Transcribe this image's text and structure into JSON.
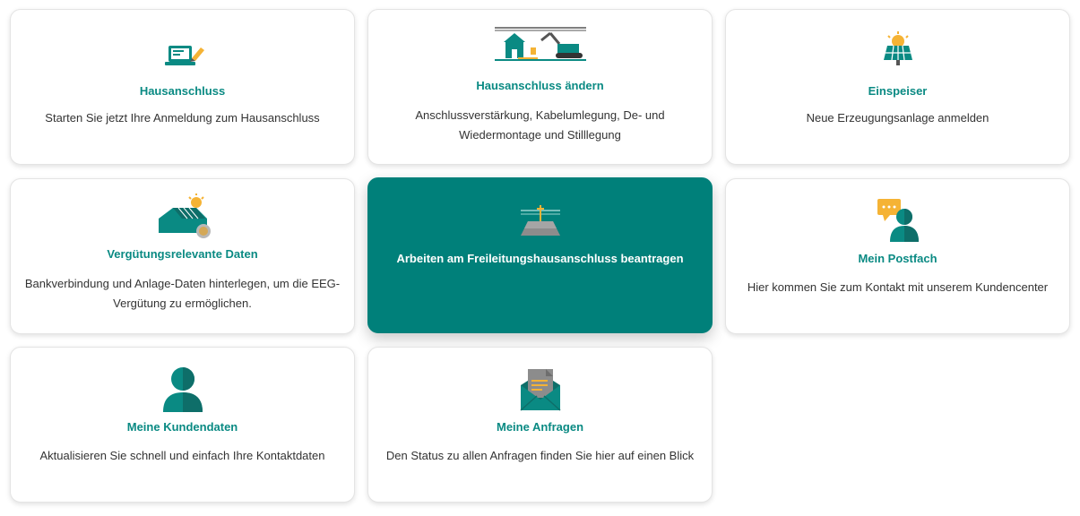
{
  "colors": {
    "brand": "#0a8a83",
    "active_card": "#00807a",
    "accent_yellow": "#f5b335"
  },
  "cards": [
    {
      "icon": "laptop-pen-icon",
      "title": "Hausanschluss",
      "description": "Starten Sie jetzt Ihre Anmeldung zum Hausanschluss"
    },
    {
      "icon": "house-excavator-icon",
      "title": "Hausanschluss ändern",
      "description": "Anschlussverstärkung, Kabelumlegung, De- und Wiedermontage und Stilllegung"
    },
    {
      "icon": "solar-panel-icon",
      "title": "Einspeiser",
      "description": "Neue Erzeugungsanlage anmelden"
    },
    {
      "icon": "solar-roof-coin-icon",
      "title": "Vergütungsrelevante Daten",
      "description": "Bankverbindung und Anlage-Daten hinterlegen, um die EEG-Vergütung zu ermöglichen."
    },
    {
      "icon": "roof-powerline-icon",
      "title": "Arbeiten am Freileitungshausanschluss beantragen",
      "description": ""
    },
    {
      "icon": "chat-person-icon",
      "title": "Mein Postfach",
      "description": "Hier kommen Sie zum Kontakt mit unserem Kundencenter"
    },
    {
      "icon": "person-icon",
      "title": "Meine Kundendaten",
      "description": "Aktualisieren Sie schnell und einfach Ihre Kontaktdaten"
    },
    {
      "icon": "envelope-document-icon",
      "title": "Meine Anfragen",
      "description": "Den Status zu allen Anfragen finden Sie hier auf einen Blick"
    }
  ]
}
